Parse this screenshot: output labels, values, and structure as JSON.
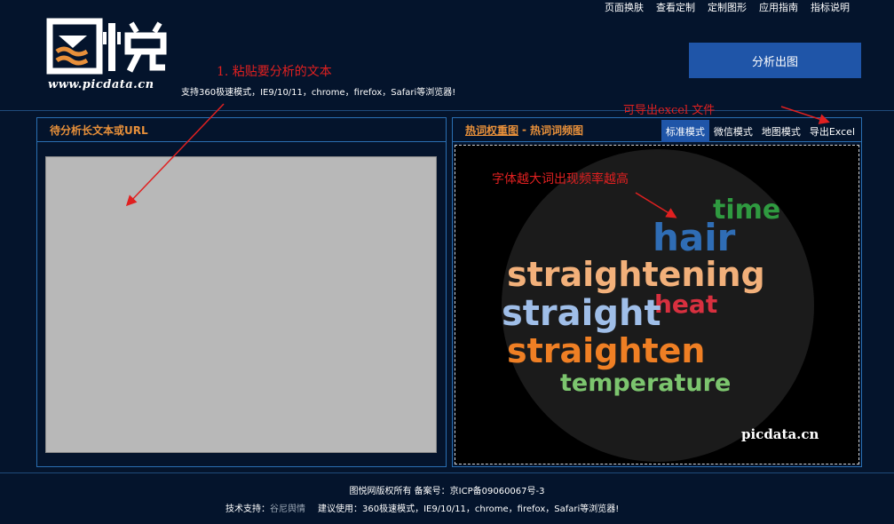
{
  "nav": {
    "items": [
      "页面换肤",
      "查看定制",
      "定制图形",
      "应用指南",
      "指标说明"
    ]
  },
  "logo": {
    "text": "图悦",
    "sub": "www.picdata.cn"
  },
  "header": {
    "support_text": "支持360极速模式，IE9/10/11，chrome，firefox，Safari等浏览器!",
    "analyze_button": "分析出图"
  },
  "left_panel": {
    "title": "待分析长文本或URL",
    "textarea_value": ""
  },
  "right_panel": {
    "title_a": "热词权重图",
    "title_sep": "-",
    "title_b": "热词词频图",
    "modes": [
      "标准模式",
      "微信模式",
      "地图模式",
      "导出Excel"
    ],
    "active_mode": 0
  },
  "wordcloud": {
    "words": [
      {
        "text": "straightening",
        "color": "#f2b07a"
      },
      {
        "text": "straight",
        "color": "#9fbee8"
      },
      {
        "text": "straighten",
        "color": "#ef7f24"
      },
      {
        "text": "hair",
        "color": "#2f6db5"
      },
      {
        "text": "temperature",
        "color": "#7cc56e"
      },
      {
        "text": "heat",
        "color": "#d8303f"
      },
      {
        "text": "time",
        "color": "#2f9a40"
      }
    ],
    "watermark": "picdata.cn",
    "circle_color": "#1b1b1b"
  },
  "annotations": {
    "paste": "1.  粘贴要分析的文本",
    "export": "可导出excel 文件",
    "font_size": "字体越大词出现频率越高"
  },
  "footer": {
    "line1": "图悦网版权所有 备案号：京ICP备09060067号-3",
    "tech_label": "技术支持：",
    "tech_value": "谷尼舆情",
    "suggest": "建议使用：360极速模式，IE9/10/11，chrome，firefox，Safari等浏览器!"
  },
  "colors": {
    "background": "#04142c",
    "accent": "#1f55a8",
    "panel_title": "#e8903a",
    "annotation": "#e02020"
  }
}
